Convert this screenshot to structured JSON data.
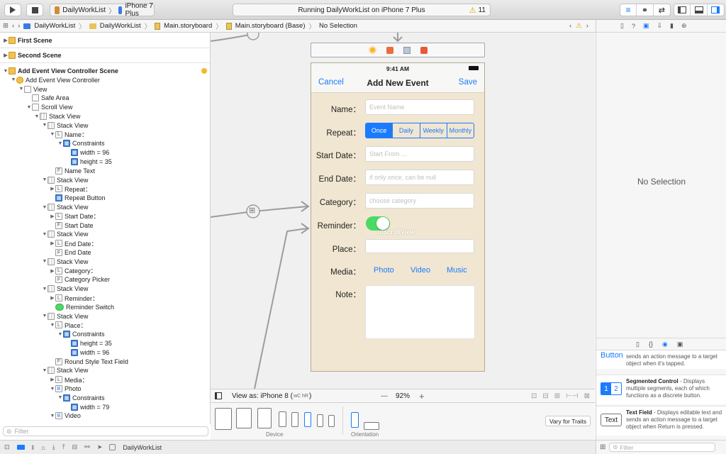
{
  "toolbar": {
    "scheme_app": "DailyWorkList",
    "scheme_device": "iPhone 7 Plus",
    "status_text": "Running DailyWorkList on iPhone 7 Plus",
    "warning_count": "11"
  },
  "jumpbar": {
    "items": [
      "DailyWorkList",
      "DailyWorkList",
      "Main.storyboard",
      "Main.storyboard (Base)",
      "No Selection"
    ]
  },
  "outline": {
    "rows": [
      {
        "t": "First Scene",
        "i": "scene",
        "d": 0,
        "tri": "▶"
      },
      {
        "t": "Second Scene",
        "i": "scene",
        "d": 0,
        "tri": "▶"
      },
      {
        "t": "Add Event View Controller Scene",
        "i": "scene",
        "d": 0,
        "tri": "▼"
      },
      {
        "t": "Add Event View Controller",
        "i": "vc",
        "d": 1,
        "tri": "▼"
      },
      {
        "t": "View",
        "i": "view",
        "d": 2,
        "tri": "▼"
      },
      {
        "t": "Safe Area",
        "i": "view",
        "d": 3,
        "tri": ""
      },
      {
        "t": "Scroll View",
        "i": "view",
        "d": 3,
        "tri": "▼"
      },
      {
        "t": "Stack View",
        "i": "stack",
        "d": 4,
        "tri": "▼"
      },
      {
        "t": "Stack View",
        "i": "stack",
        "d": 5,
        "tri": "▼"
      },
      {
        "t": "Name：",
        "i": "L",
        "d": 6,
        "tri": "▼"
      },
      {
        "t": "Constraints",
        "i": "blue",
        "d": 7,
        "tri": "▼"
      },
      {
        "t": "width = 96",
        "i": "blue",
        "d": 8,
        "tri": ""
      },
      {
        "t": "height = 35",
        "i": "blue",
        "d": 8,
        "tri": ""
      },
      {
        "t": "Name Text",
        "i": "F",
        "d": 6,
        "tri": ""
      },
      {
        "t": "Stack View",
        "i": "stack",
        "d": 5,
        "tri": "▼"
      },
      {
        "t": "Repeat：",
        "i": "L",
        "d": 6,
        "tri": "▶"
      },
      {
        "t": "Repeat Button",
        "i": "blue",
        "d": 6,
        "tri": ""
      },
      {
        "t": "Stack View",
        "i": "stack",
        "d": 5,
        "tri": "▼"
      },
      {
        "t": "Start Date：",
        "i": "L",
        "d": 6,
        "tri": "▶"
      },
      {
        "t": "Start Date",
        "i": "F",
        "d": 6,
        "tri": ""
      },
      {
        "t": "Stack View",
        "i": "stack",
        "d": 5,
        "tri": "▼"
      },
      {
        "t": "End Date：",
        "i": "L",
        "d": 6,
        "tri": "▶"
      },
      {
        "t": "End Date",
        "i": "F",
        "d": 6,
        "tri": ""
      },
      {
        "t": "Stack View",
        "i": "stack",
        "d": 5,
        "tri": "▼"
      },
      {
        "t": "Category：",
        "i": "L",
        "d": 6,
        "tri": "▶"
      },
      {
        "t": "Category Picker",
        "i": "F",
        "d": 6,
        "tri": ""
      },
      {
        "t": "Stack View",
        "i": "stack",
        "d": 5,
        "tri": "▼"
      },
      {
        "t": "Reminder：",
        "i": "L",
        "d": 6,
        "tri": "▶"
      },
      {
        "t": "Reminder Switch",
        "i": "sw",
        "d": 6,
        "tri": ""
      },
      {
        "t": "Stack View",
        "i": "stack",
        "d": 5,
        "tri": "▼"
      },
      {
        "t": "Place：",
        "i": "L",
        "d": 6,
        "tri": "▼"
      },
      {
        "t": "Constraints",
        "i": "blue",
        "d": 7,
        "tri": "▼"
      },
      {
        "t": "height = 35",
        "i": "blue",
        "d": 8,
        "tri": ""
      },
      {
        "t": "width = 96",
        "i": "blue",
        "d": 8,
        "tri": ""
      },
      {
        "t": "Round Style Text Field",
        "i": "F",
        "d": 6,
        "tri": ""
      },
      {
        "t": "Stack View",
        "i": "stack",
        "d": 5,
        "tri": "▼"
      },
      {
        "t": "Media：",
        "i": "L",
        "d": 6,
        "tri": "▶"
      },
      {
        "t": "Photo",
        "i": "B",
        "d": 6,
        "tri": "▼"
      },
      {
        "t": "Constraints",
        "i": "blue",
        "d": 7,
        "tri": "▼"
      },
      {
        "t": "width = 79",
        "i": "blue",
        "d": 8,
        "tri": ""
      },
      {
        "t": "Video",
        "i": "B",
        "d": 6,
        "tri": "▼"
      }
    ],
    "filter_placeholder": "Filter"
  },
  "phone": {
    "time": "9:41 AM",
    "nav_cancel": "Cancel",
    "nav_title": "Add New Event",
    "nav_save": "Save",
    "labels": {
      "name": "Name：",
      "repeat": "Repeat：",
      "start": "Start Date：",
      "end": "End Date：",
      "category": "Category：",
      "reminder": "Reminder：",
      "place": "Place：",
      "media": "Media：",
      "note": "Note："
    },
    "placeholders": {
      "name": "Event Name",
      "start": "Start From ...",
      "end": "if only once, can be null",
      "category": "choose category"
    },
    "repeat_options": [
      "Once",
      "Daily",
      "Weekly",
      "Monthly"
    ],
    "media_buttons": [
      "Photo",
      "Video",
      "Music"
    ],
    "overlay_label": "uiscrollView"
  },
  "canvas_bar": {
    "view_as": "View as: iPhone 8 (",
    "size_class": "wC hR",
    "close_paren": ")",
    "minus": "—",
    "zoom": "92%",
    "plus": "+"
  },
  "device_bar": {
    "device_label": "Device",
    "orientation_label": "Orientation",
    "vary_button": "Vary for Traits"
  },
  "inspector": {
    "no_selection": "No Selection",
    "library": [
      {
        "title": "Button",
        "desc": "sends an action message to a target object when it's tapped."
      },
      {
        "title": "Segmented Control",
        "desc": "Displays multiple segments, each of which functions as a discrete button."
      },
      {
        "title": "Text Field",
        "desc": "Displays editable text and sends an action message to a target object when Return is pressed."
      }
    ],
    "filter_placeholder": "Filter"
  },
  "bottombar": {
    "target": "DailyWorkList"
  }
}
